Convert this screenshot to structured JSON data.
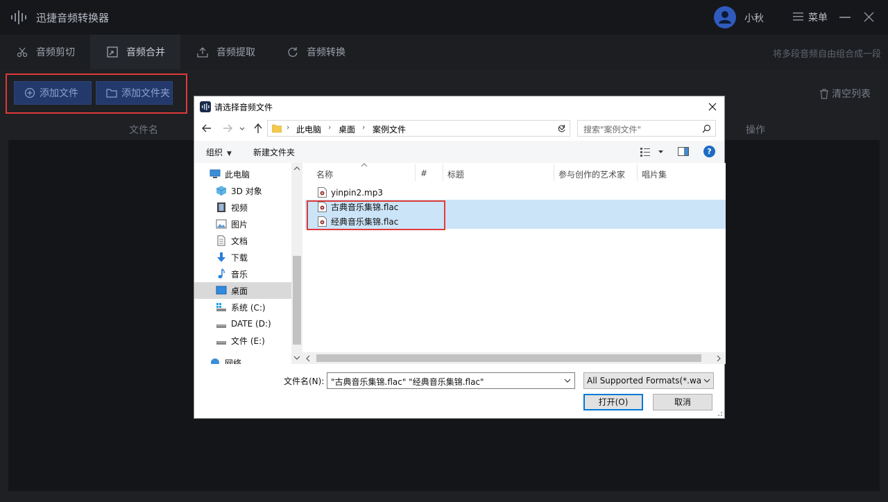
{
  "app": {
    "title": "迅捷音频转换器",
    "user_name": "小秋",
    "menu_label": "菜单",
    "tabs": [
      {
        "label": "音频剪切",
        "icon": "scissors-icon"
      },
      {
        "label": "音频合并",
        "icon": "merge-icon"
      },
      {
        "label": "音频提取",
        "icon": "upload-icon"
      },
      {
        "label": "音频转换",
        "icon": "refresh-icon"
      }
    ],
    "active_tab": "音频合并",
    "tab_hint": "将多段音频自由组合成一段",
    "add_file_label": "添加文件",
    "add_folder_label": "添加文件夹",
    "clear_list_label": "清空列表",
    "columns": {
      "file_name": "文件名",
      "operation": "操作"
    }
  },
  "dialog": {
    "title": "请选择音频文件",
    "breadcrumbs": [
      "此电脑",
      "桌面",
      "案例文件"
    ],
    "search_placeholder": "搜索\"案例文件\"",
    "toolbar": {
      "organize": "组织",
      "new_folder": "新建文件夹"
    },
    "tree": [
      {
        "label": "此电脑",
        "icon": "computer-icon",
        "level": 0
      },
      {
        "label": "3D 对象",
        "icon": "cube-icon",
        "level": 1
      },
      {
        "label": "视频",
        "icon": "video-icon",
        "level": 1
      },
      {
        "label": "图片",
        "icon": "picture-icon",
        "level": 1
      },
      {
        "label": "文档",
        "icon": "document-icon",
        "level": 1
      },
      {
        "label": "下载",
        "icon": "download-icon",
        "level": 1
      },
      {
        "label": "音乐",
        "icon": "music-icon",
        "level": 1
      },
      {
        "label": "桌面",
        "icon": "desktop-icon",
        "level": 1,
        "selected": true
      },
      {
        "label": "系统 (C:)",
        "icon": "system-drive-icon",
        "level": 1
      },
      {
        "label": "DATE (D:)",
        "icon": "drive-icon",
        "level": 1
      },
      {
        "label": "文件 (E:)",
        "icon": "drive-icon",
        "level": 1
      },
      {
        "label": "网络",
        "icon": "network-icon",
        "level": 0
      }
    ],
    "columns": [
      "名称",
      "#",
      "标题",
      "参与创作的艺术家",
      "唱片集"
    ],
    "files": [
      {
        "name": "yinpin2.mp3",
        "selected": false
      },
      {
        "name": "古典音乐集锦.flac",
        "selected": true
      },
      {
        "name": "经典音乐集锦.flac",
        "selected": true
      }
    ],
    "filename_label": "文件名(N):",
    "filename_value": "\"古典音乐集锦.flac\" \"经典音乐集锦.flac\"",
    "filetype_value": "All Supported Formats(*.wav",
    "open_label": "打开(O)",
    "cancel_label": "取消"
  },
  "colors": {
    "accent_red": "#e03a3a",
    "selection_blue": "#cce4f7",
    "app_button": "#23396b"
  }
}
